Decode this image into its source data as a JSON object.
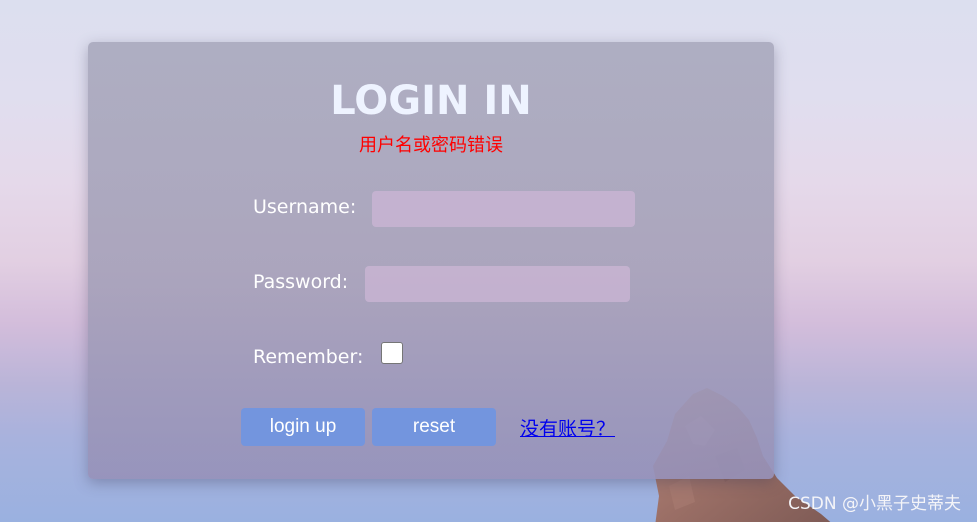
{
  "login": {
    "title": "LOGIN IN",
    "error_message": "用户名或密码错误",
    "username_label": "Username:",
    "username_value": "",
    "password_label": "Password:",
    "password_value": "",
    "remember_label": "Remember:",
    "remember_checked": false,
    "login_button_label": "login up",
    "reset_button_label": "reset",
    "register_link_label": "没有账号？"
  },
  "watermark": "CSDN @小黑子史蒂夫",
  "colors": {
    "error": "#ff0000",
    "button": "#7395de",
    "link": "#0000ee",
    "title": "#eef3ff"
  }
}
